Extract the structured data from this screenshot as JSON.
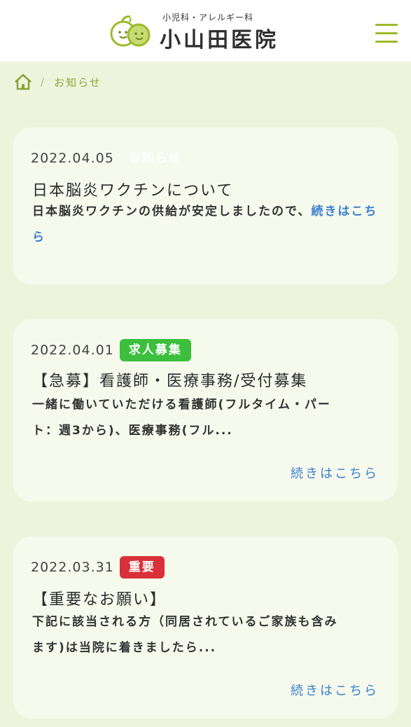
{
  "header": {
    "logo_subtitle": "小児科・アレルギー科",
    "logo_title": "小山田医院",
    "menu_icon": "hamburger-menu-icon",
    "accent_color": "#9cbb2a"
  },
  "breadcrumb": {
    "home_icon": "home-icon",
    "separator": "/",
    "current": "お知らせ"
  },
  "posts": [
    {
      "date": "2022.04.05",
      "category": "お知らせ",
      "title": "日本脳炎ワクチンについて",
      "excerpt": "日本脳炎ワクチンの供給が安定しましたので、",
      "more": "続きはこちら"
    },
    {
      "date": "2022.04.01",
      "category": "求人募集",
      "category_color": "#3cbf3c",
      "title": "【急募】看護師・医療事務/受付募集",
      "excerpt_line1": "一緒に働いていただける看護師(フルタイム・パー",
      "excerpt_line2": "ト：週3から)、医療事務(フル...",
      "more": "続きはこちら"
    },
    {
      "date": "2022.03.31",
      "category": "重要",
      "category_color": "#d9303a",
      "title": "【重要なお願い】",
      "excerpt_line1": "下記に該当される方（同居されているご家族も含み",
      "excerpt_line2": "ます)は当院に着きましたら...",
      "more": "続きはこちら"
    }
  ]
}
